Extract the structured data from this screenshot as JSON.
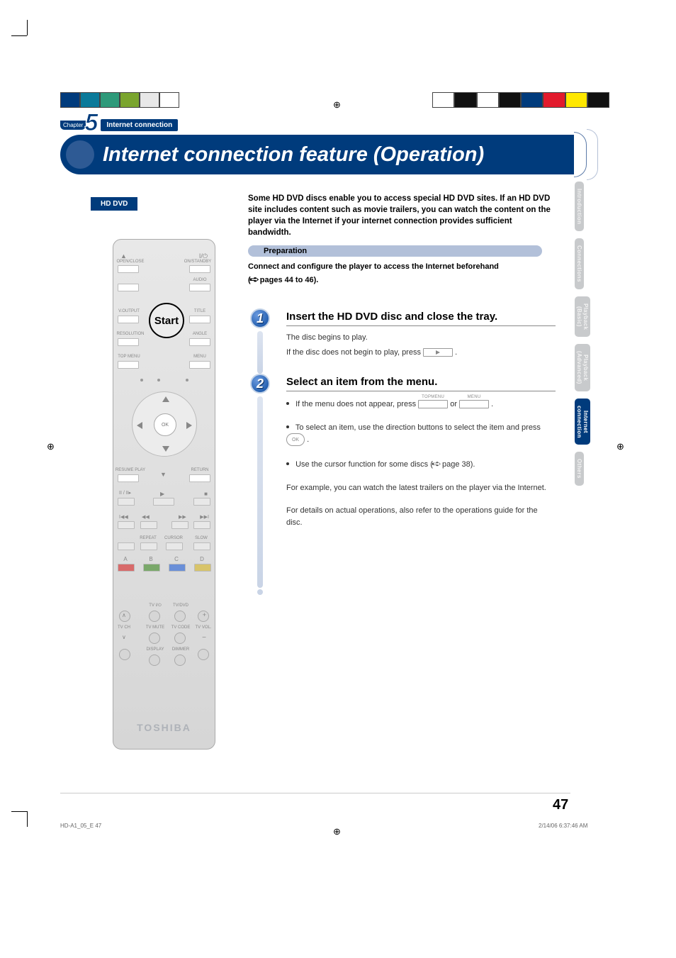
{
  "chapter": {
    "label": "Chapter",
    "number": "5",
    "title": "Internet connection"
  },
  "banner_title": "Internet connection feature (Operation)",
  "badge": "HD DVD",
  "intro": "Some HD DVD discs enable you to access special HD DVD sites. If an HD DVD site includes content such as movie trailers, you can watch the content on the player via the Internet if your internet connection provides sufficient bandwidth.",
  "preparation": {
    "label": "Preparation",
    "line1": "Connect and configure the player to access the Internet beforehand",
    "line2": "pages 44 to 46)."
  },
  "steps": {
    "s1": {
      "num": "1",
      "heading": "Insert the HD DVD disc and close the tray.",
      "body_a": "The disc begins to play.",
      "body_b_pre": "If the disc does not begin to play, press",
      "body_b_post": "."
    },
    "s2": {
      "num": "2",
      "heading": "Select an item from the menu.",
      "bullet1_pre": "If the menu does not appear, press",
      "bullet1_mid": "or",
      "bullet1_post": ".",
      "btn_topmenu": "TOPMENU",
      "btn_menu": "MENU",
      "bullet2_pre": "To select an item, use the direction buttons to select the item and press",
      "bullet2_post": ".",
      "ok_label": "OK",
      "bullet3_pre": "Use the cursor function for some discs (",
      "bullet3_ref": "page 38).",
      "para1": "For example, you can watch the latest trailers on the player via the Internet.",
      "para2": "For details on actual operations, also refer to the operations guide for the disc."
    }
  },
  "side_tabs": {
    "t1": "Introduction",
    "t2": "Connections",
    "t3a": "Playback",
    "t3b": "(Basic)",
    "t4a": "Playback",
    "t4b": "(Advanced)",
    "t5a": "Internet",
    "t5b": "connection",
    "t6": "Others"
  },
  "remote": {
    "openclose": "OPEN/CLOSE",
    "onstandby": "ON/STANDBY",
    "audio": "AUDIO",
    "voutput": "V.OUTPUT",
    "start": "Start",
    "title": "TITLE",
    "resolution": "RESOLUTION",
    "angle": "ANGLE",
    "topmenu": "TOP MENU",
    "menu": "MENU",
    "ok": "OK",
    "resumeplay": "RESUME PLAY",
    "return": "RETURN",
    "repeat": "REPEAT",
    "cursor": "CURSOR",
    "slow": "SLOW",
    "a": "A",
    "b": "B",
    "c": "C",
    "d": "D",
    "tvio": "TV I/⏻",
    "tvdvd": "TV/DVD",
    "tvmute": "TV MUTE",
    "tvcode": "TV CODE",
    "tvch": "TV CH",
    "tvvol": "TV VOL.",
    "display": "DISPLAY",
    "dimmer": "DIMMER",
    "logo": "TOSHIBA"
  },
  "page_number": "47",
  "footer_left": "HD-A1_05_E   47",
  "footer_right": "2/14/06   6:37:46 AM"
}
